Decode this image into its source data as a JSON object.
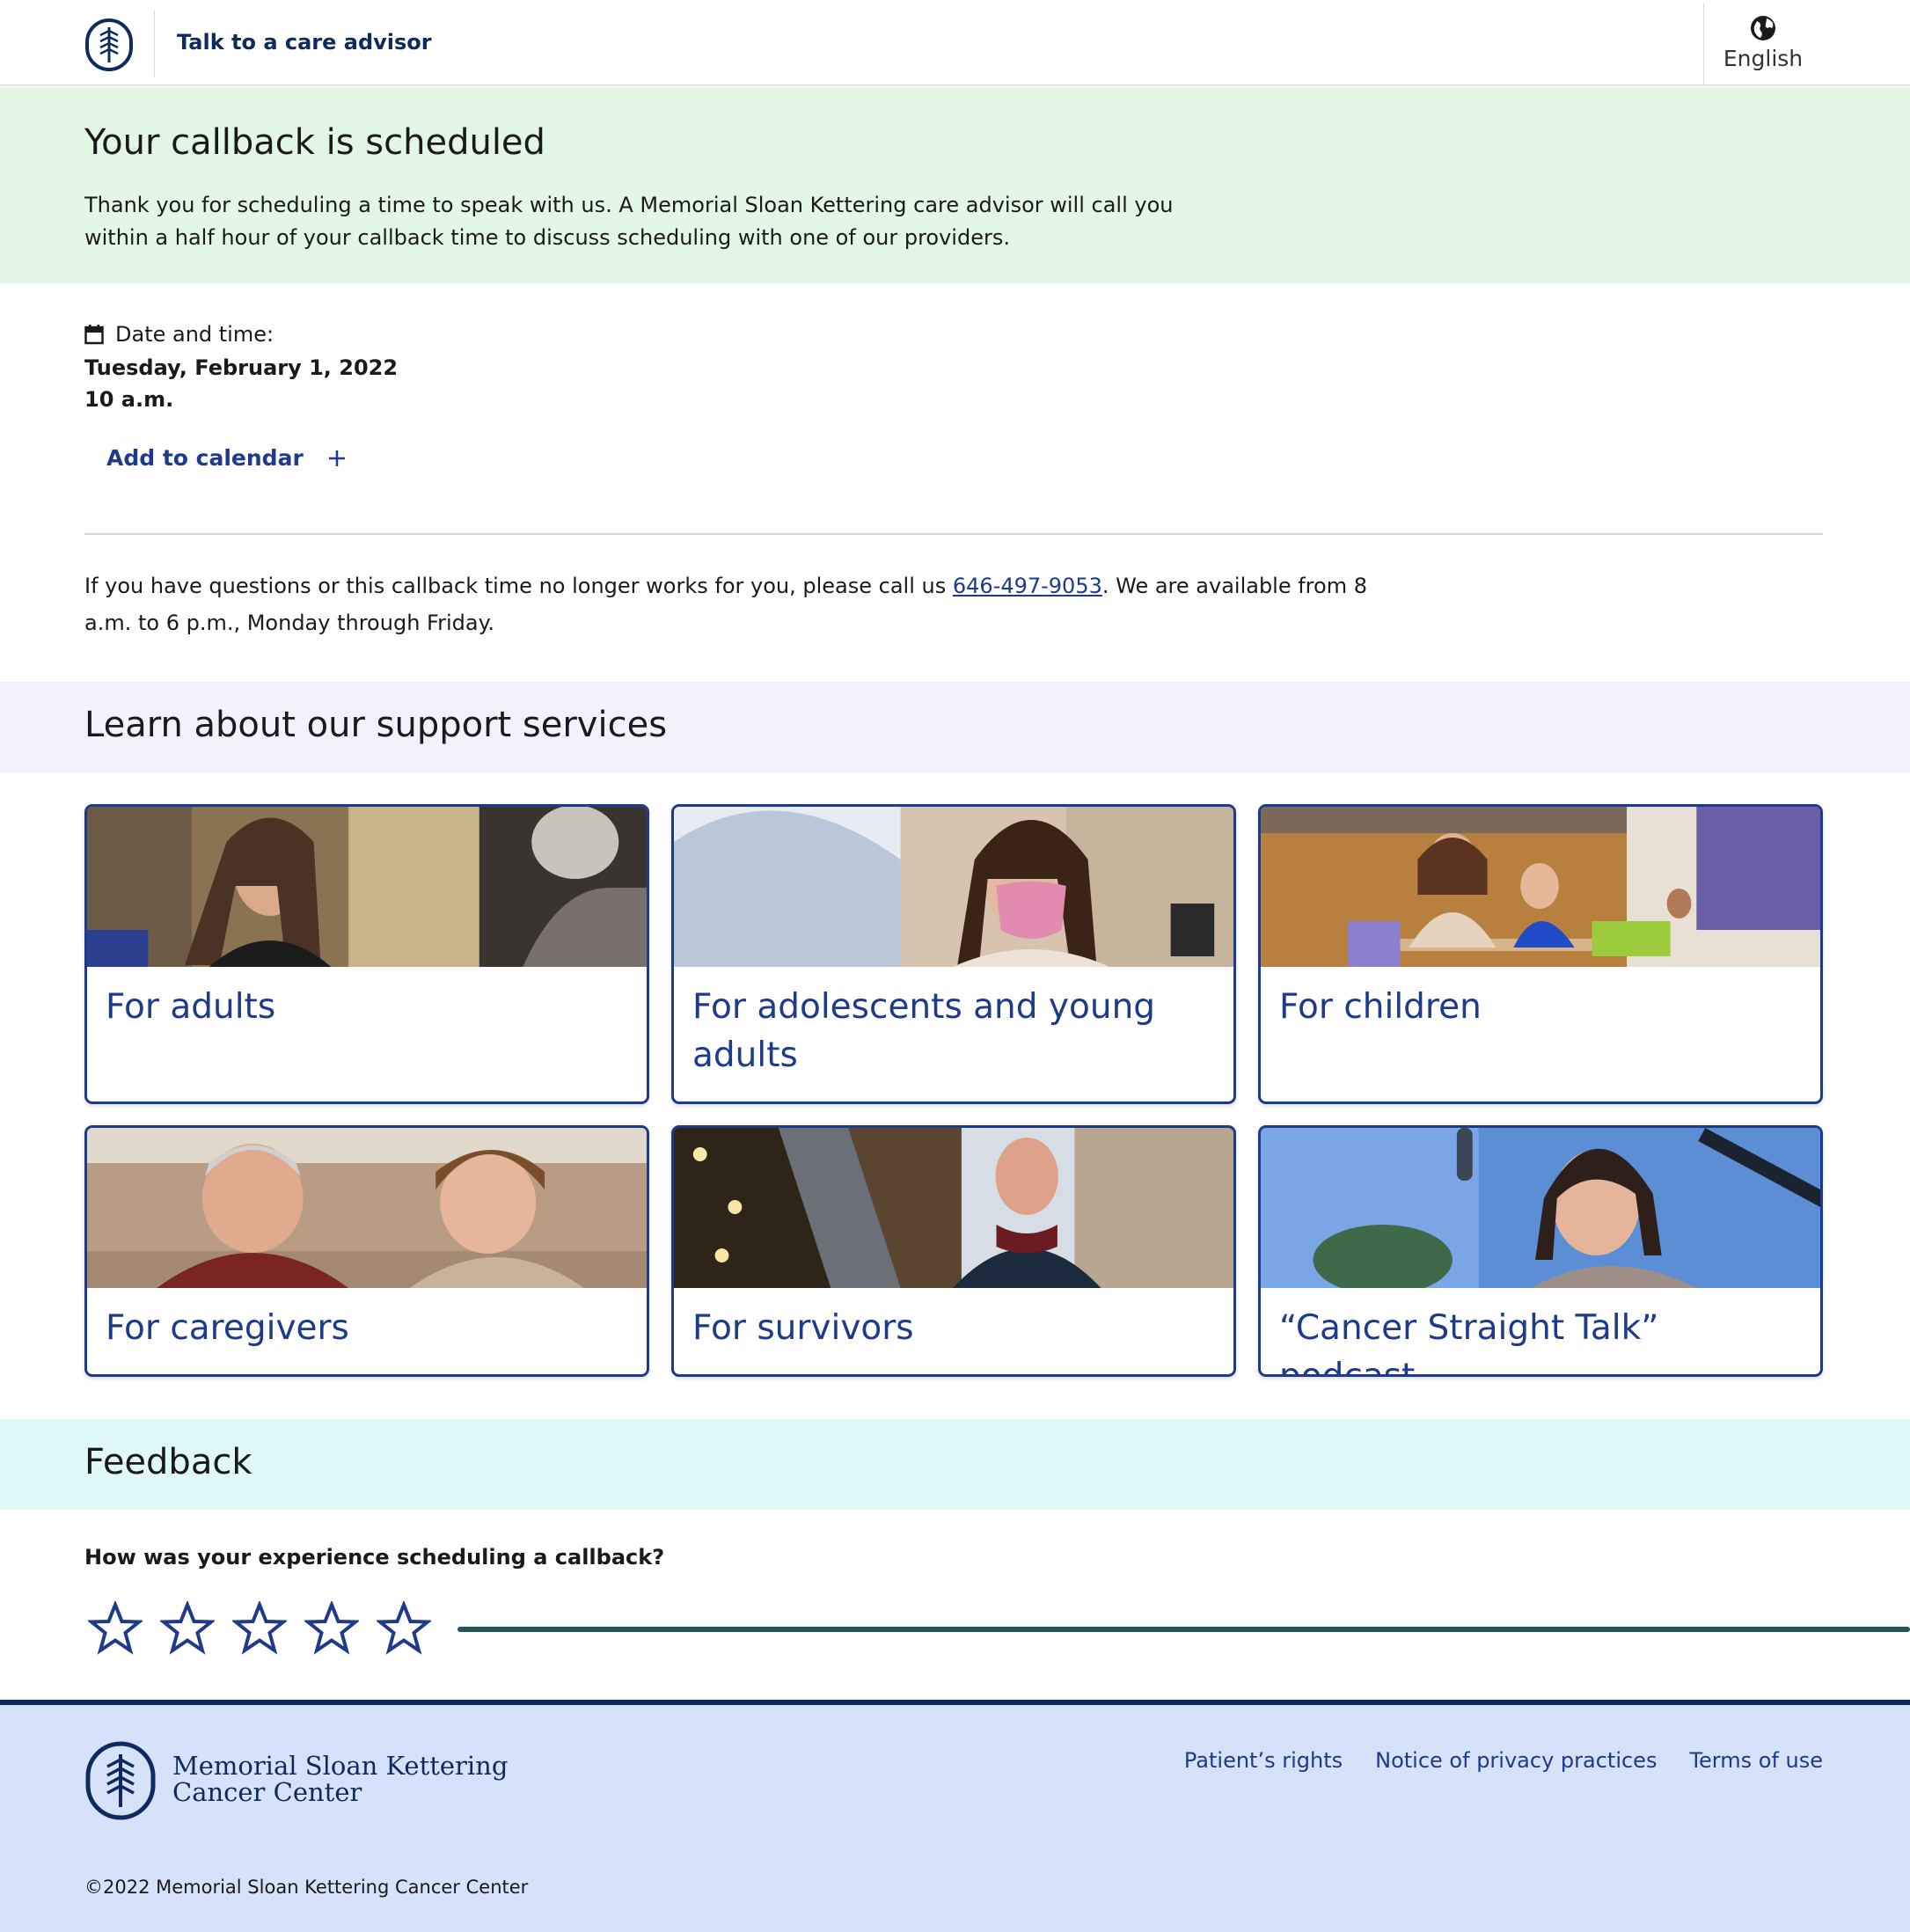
{
  "header": {
    "advisor_link": "Talk to a care advisor",
    "language": "English",
    "logo_icon": "msk-logo-icon",
    "globe_icon": "globe-icon"
  },
  "banner": {
    "title": "Your callback is scheduled",
    "body": "Thank you for scheduling a time to speak with us. A Memorial Sloan Kettering care advisor will call you within a half hour of your callback time to discuss scheduling with one of our providers."
  },
  "appointment": {
    "label": "Date and time:",
    "date": "Tuesday, February 1, 2022",
    "time": "10 a.m.",
    "add_to_calendar": "Add to calendar"
  },
  "help": {
    "text_before": "If you have questions or this callback time no longer works for you, please call us ",
    "phone": "646-497-9053",
    "text_after": ". We are available from 8 a.m. to 6 p.m., Monday through Friday."
  },
  "support": {
    "heading": "Learn about our support services",
    "cards": [
      {
        "label": "For adults"
      },
      {
        "label": "For adolescents and young adults"
      },
      {
        "label": "For children"
      },
      {
        "label": "For caregivers"
      },
      {
        "label": "For survivors"
      },
      {
        "label": "“Cancer Straight Talk” podcast"
      }
    ]
  },
  "feedback": {
    "heading": "Feedback",
    "question": "How was your experience scheduling a callback?",
    "rating_max": 5,
    "rating_value": 0
  },
  "footer": {
    "org_line1": "Memorial Sloan Kettering",
    "org_line2": "Cancer Center",
    "links": [
      "Patient’s rights",
      "Notice of privacy practices",
      "Terms of use"
    ],
    "copyright": "©2022 Memorial Sloan Kettering Cancer Center"
  },
  "colors": {
    "brand_navy": "#0e2a5e",
    "link_blue": "#1e3a8a",
    "banner_green": "#e3f7e5",
    "support_lavender": "#f3f1fc",
    "feedback_cyan": "#dff8f8",
    "footer_blue": "#d6e1fa"
  }
}
